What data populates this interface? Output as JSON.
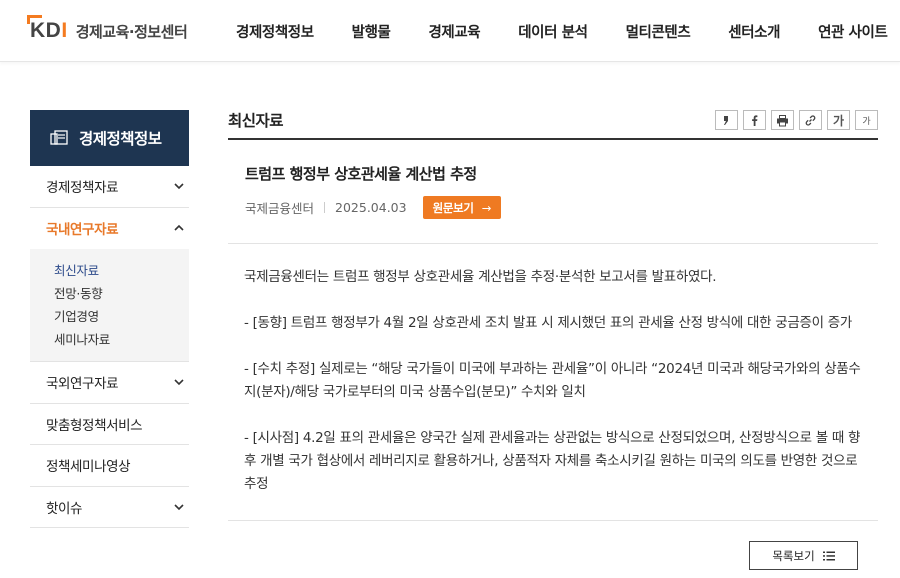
{
  "header": {
    "logo_mark": "KDI",
    "logo_text": "경제교육·정보센터",
    "nav": [
      "경제정책정보",
      "발행물",
      "경제교육",
      "데이터 분석",
      "멀티콘텐츠",
      "센터소개",
      "연관 사이트"
    ]
  },
  "sidebar": {
    "title": "경제정책정보",
    "items": [
      {
        "label": "경제정책자료",
        "icon": "chevron-down-icon"
      },
      {
        "label": "국내연구자료",
        "icon": "chevron-up-icon"
      },
      {
        "label": "국외연구자료",
        "icon": "chevron-down-icon"
      },
      {
        "label": "맞춤형정책서비스"
      },
      {
        "label": "정책세미나영상"
      },
      {
        "label": "핫이슈",
        "icon": "chevron-down-icon"
      }
    ],
    "submenu": [
      "최신자료",
      "전망·동향",
      "기업경영",
      "세미나자료"
    ],
    "active_color": "#e8792a",
    "title_bg": "#1e3551"
  },
  "content": {
    "section_title": "최신자료",
    "tools": [
      "quote-icon",
      "facebook-icon",
      "print-icon",
      "link-icon",
      "font-increase-icon",
      "font-decrease-icon"
    ],
    "font_large": "가",
    "font_small": "가",
    "article": {
      "title": "트럼프 행정부 상호관세율 계산법 추정",
      "source": "국제금융센터",
      "date": "2025.04.03",
      "origin_button": "원문보기",
      "paragraphs": [
        "국제금융센터는 트럼프 행정부 상호관세율 계산법을 추정·분석한 보고서를 발표하였다.",
        "- [동향] 트럼프 행정부가 4월 2일 상호관세 조치 발표 시 제시했던 표의 관세율 산정 방식에 대한 궁금증이 증가",
        "- [수치 추정] 실제로는 “해당 국가들이 미국에 부과하는 관세율”이 아니라 “2024년 미국과 해당국가와의 상품수지(분자)/해당 국가로부터의 미국 상품수입(분모)” 수치와 일치",
        "- [시사점] 4.2일 표의 관세율은 양국간 실제 관세율과는 상관없는 방식으로 산정되었으며, 산정방식으로 볼 때 향후 개별 국가 협상에서 레버리지로 활용하거나, 상품적자 자체를 축소시키길 원하는 미국의 의도를 반영한 것으로 추정"
      ]
    },
    "list_button": "목록보기",
    "accent_color": "#ef7a22"
  }
}
